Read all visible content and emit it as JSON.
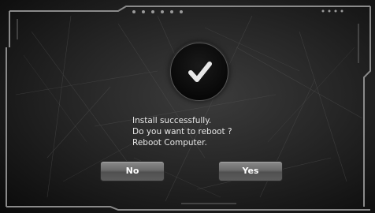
{
  "dialog": {
    "icon": "checkmark-icon",
    "message_lines": [
      "Install successfully.",
      "Do you want to reboot ?",
      "Reboot Computer."
    ],
    "no_label": "No",
    "yes_label": "Yes"
  },
  "colors": {
    "background": "#262626",
    "frame": "#8a8a8a",
    "text": "#e6e6e6",
    "button": "#6a6a6a"
  }
}
